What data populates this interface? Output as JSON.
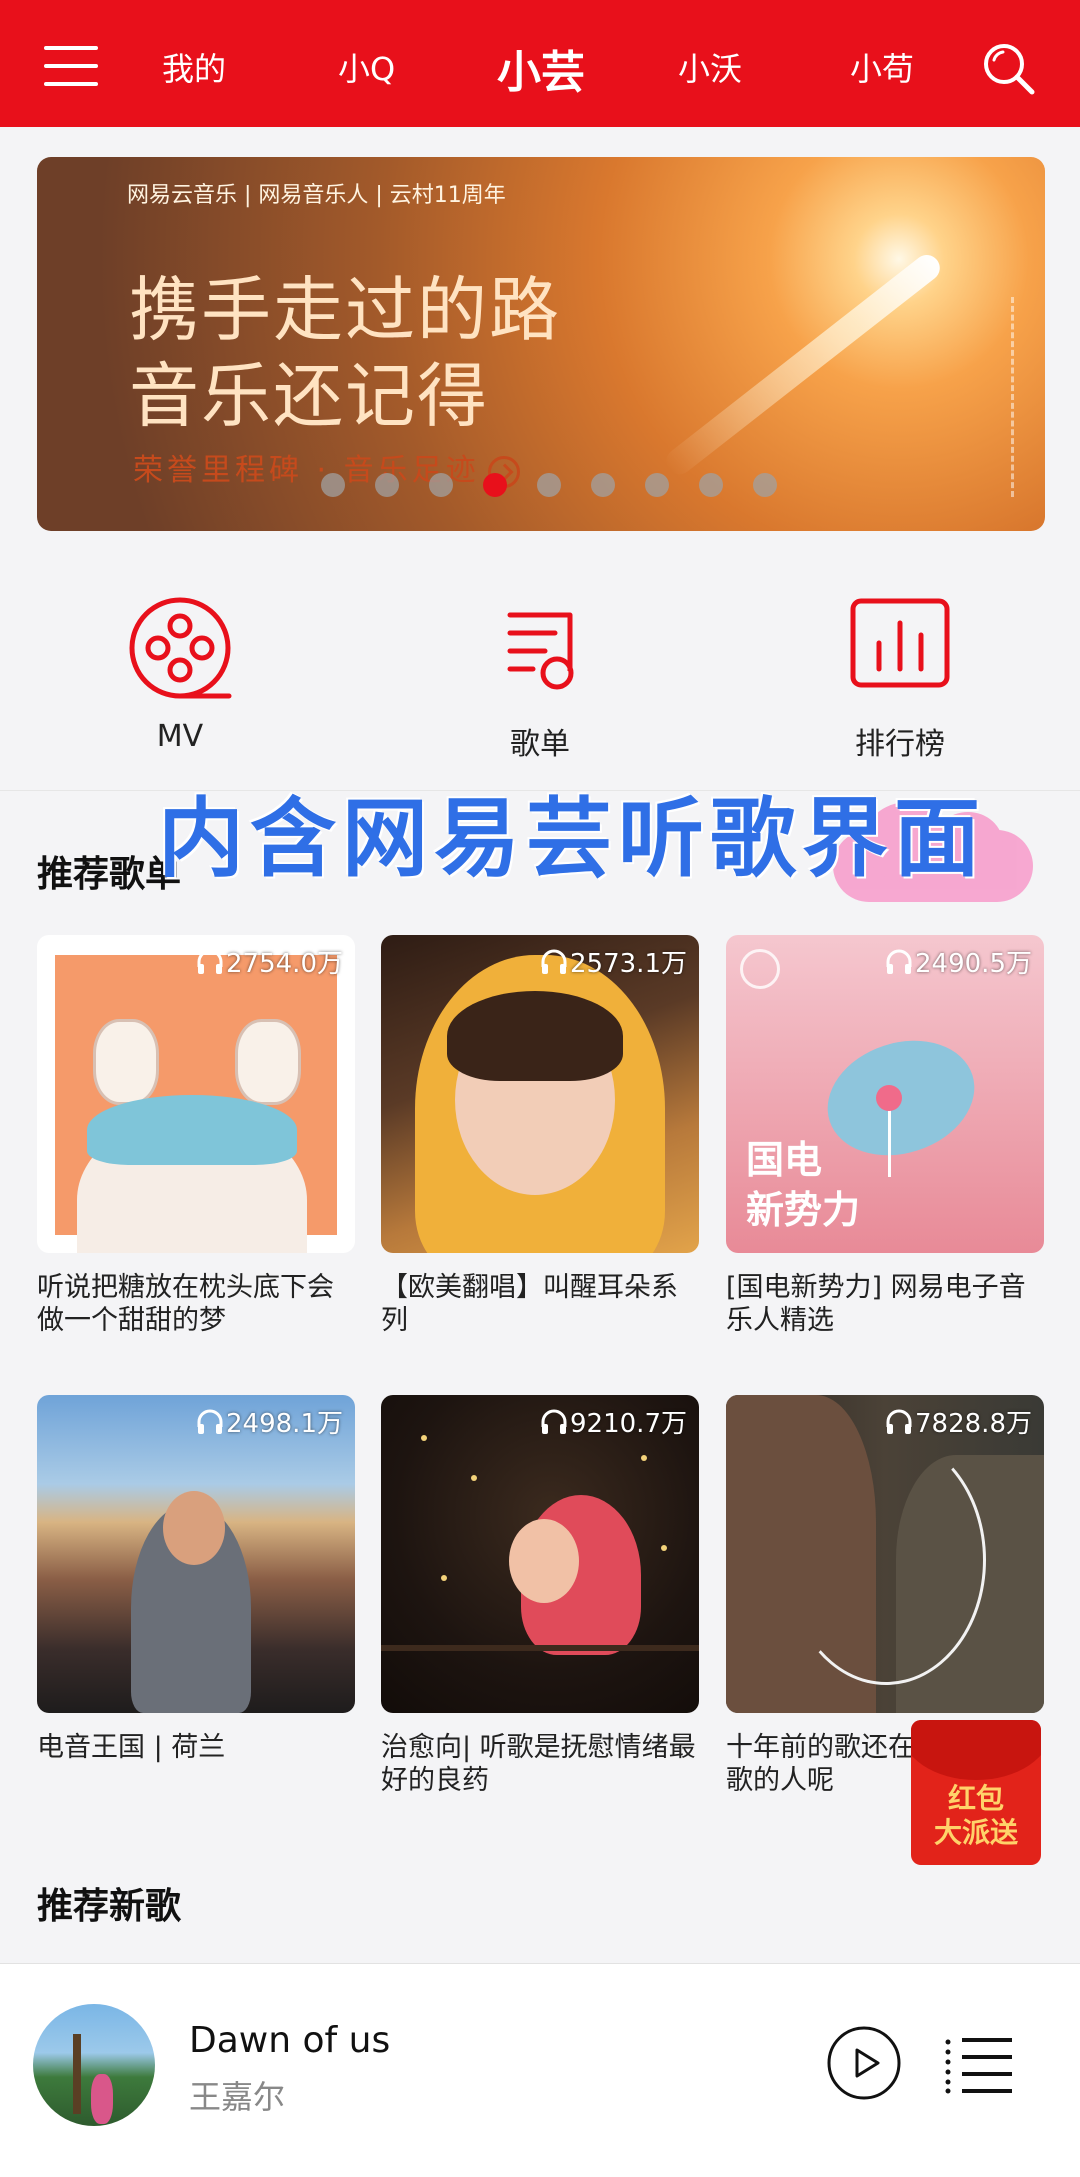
{
  "topbar": {
    "tabs": [
      "我的",
      "小Q",
      "小芸",
      "小沃",
      "小苟"
    ],
    "active_tab": "小芸",
    "color": "#e8101b"
  },
  "banner": {
    "brandline": "网易云音乐 | 网易音乐人 | 云村11周年",
    "headline_1": "携手走过的路",
    "headline_2": "音乐还记得",
    "subline": "荣誉里程碑 · 音乐足迹",
    "dot_count": 9,
    "active_dot": 3
  },
  "quick_entries": [
    {
      "label": "MV",
      "icon": "mv-film-reel-icon"
    },
    {
      "label": "歌单",
      "icon": "playlist-note-icon"
    },
    {
      "label": "排行榜",
      "icon": "chart-ranking-icon"
    }
  ],
  "overlay_caption": "内含网易芸听歌界面",
  "recommend_playlists": {
    "title": "推荐歌单",
    "items": [
      {
        "count": "2754.0万",
        "title": "听说把糖放在枕头底下会做一个甜甜的梦"
      },
      {
        "count": "2573.1万",
        "title": "【欧美翻唱】叫醒耳朵系列"
      },
      {
        "count": "2490.5万",
        "title": "[国电新势力] 网易电子音乐人精选",
        "cover_text": "国电\n新势力"
      },
      {
        "count": "2498.1万",
        "title": "电音王国 | 荷兰"
      },
      {
        "count": "9210.7万",
        "title": "治愈向| 听歌是抚慰情绪最好的良药"
      },
      {
        "count": "7828.8万",
        "title": "十年前的歌还在，一起听歌的人呢"
      }
    ]
  },
  "red_packet": {
    "line1": "红包",
    "line2": "大派送"
  },
  "recommend_songs": {
    "title": "推荐新歌"
  },
  "player": {
    "song": "Dawn of us",
    "artist": "王嘉尔"
  }
}
